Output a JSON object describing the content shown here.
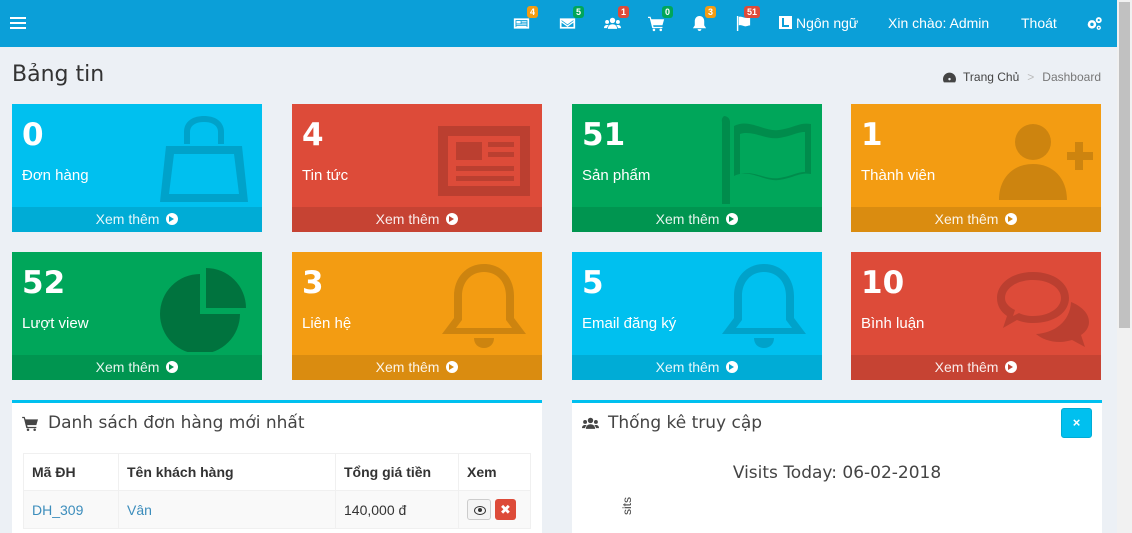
{
  "topbar": {
    "badges": {
      "orders": "4",
      "mail": "5",
      "users": "1",
      "cart": "0",
      "notifications": "3",
      "flags": "51"
    },
    "language_label": "Ngôn ngữ",
    "greeting": "Xin chào: Admin",
    "logout": "Thoát",
    "colors": {
      "bar": "#0b9fd8"
    }
  },
  "header": {
    "title": "Bảng tin",
    "breadcrumb": {
      "home": "Trang Chủ",
      "current": "Dashboard"
    }
  },
  "stats": [
    {
      "value": "0",
      "label": "Đơn hàng",
      "more": "Xem thêm",
      "icon": "shopping-bag-icon",
      "color": "#00c0ef"
    },
    {
      "value": "4",
      "label": "Tin tức",
      "more": "Xem thêm",
      "icon": "newspaper-icon",
      "color": "#dd4b39"
    },
    {
      "value": "51",
      "label": "Sản phẩm",
      "more": "Xem thêm",
      "icon": "flag-icon",
      "color": "#00a65a"
    },
    {
      "value": "1",
      "label": "Thành viên",
      "more": "Xem thêm",
      "icon": "user-plus-icon",
      "color": "#f39c12"
    },
    {
      "value": "52",
      "label": "Lượt view",
      "more": "Xem thêm",
      "icon": "pie-chart-icon",
      "color": "#00a65a"
    },
    {
      "value": "3",
      "label": "Liên hệ",
      "more": "Xem thêm",
      "icon": "bell-icon",
      "color": "#f39c12"
    },
    {
      "value": "5",
      "label": "Email đăng ký",
      "more": "Xem thêm",
      "icon": "bell-icon",
      "color": "#00c0ef"
    },
    {
      "value": "10",
      "label": "Bình luận",
      "more": "Xem thêm",
      "icon": "comments-icon",
      "color": "#dd4b39"
    }
  ],
  "orders_panel": {
    "title": "Danh sách đơn hàng mới nhất",
    "columns": [
      "Mã ĐH",
      "Tên khách hàng",
      "Tổng giá tiền",
      "Xem"
    ],
    "rows": [
      {
        "code": "DH_309",
        "customer": "Vân",
        "total": "140,000 đ"
      }
    ]
  },
  "visits_panel": {
    "title": "Thống kê truy cập",
    "close": "×",
    "chart_title": "Visits Today: 06-02-2018",
    "y_label": "sits"
  }
}
